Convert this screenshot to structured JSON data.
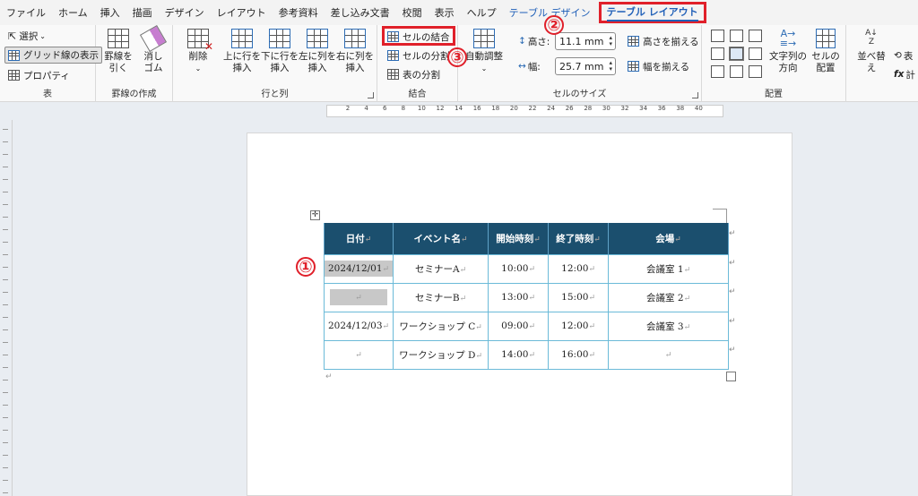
{
  "menu": {
    "items": [
      "ファイル",
      "ホーム",
      "挿入",
      "描画",
      "デザイン",
      "レイアウト",
      "参考資料",
      "差し込み文書",
      "校閲",
      "表示",
      "ヘルプ"
    ],
    "table_design": "テーブル デザイン",
    "table_layout": "テーブル レイアウト"
  },
  "ribbon": {
    "table_group": {
      "label": "表",
      "select": "選択",
      "gridlines": "グリッド線の表示",
      "properties": "プロパティ"
    },
    "draw_group": {
      "label": "罫線の作成",
      "draw_line": [
        "罫線を",
        "引く"
      ],
      "eraser": [
        "消し",
        "ゴム"
      ]
    },
    "rows_cols_group": {
      "label": "行と列",
      "delete": "削除",
      "insert_above": [
        "上に行を",
        "挿入"
      ],
      "insert_below": [
        "下に行を",
        "挿入"
      ],
      "insert_left": [
        "左に列を",
        "挿入"
      ],
      "insert_right": [
        "右に列を",
        "挿入"
      ]
    },
    "merge_group": {
      "label": "結合",
      "merge_cells": "セルの結合",
      "split_cells": "セルの分割",
      "split_table": "表の分割"
    },
    "size_group": {
      "label": "セルのサイズ",
      "autofit": "自動調整",
      "height_label": "高さ:",
      "height_value": "11.1 mm",
      "width_label": "幅:",
      "width_value": "25.7 mm",
      "distribute_rows": "高さを揃える",
      "distribute_cols": "幅を揃える"
    },
    "align_group": {
      "label": "配置",
      "text_direction": [
        "文字列の",
        "方向"
      ],
      "cell_margins": [
        "セルの",
        "配置"
      ]
    },
    "data_group": {
      "sort": "並べ替え",
      "repeat": "表",
      "formula": "計"
    }
  },
  "ruler": {
    "ticks": [
      "2",
      "4",
      "6",
      "8",
      "10",
      "12",
      "14",
      "16",
      "18",
      "20",
      "22",
      "24",
      "26",
      "28",
      "30",
      "32",
      "34",
      "36",
      "38",
      "40"
    ]
  },
  "badges": {
    "one": "①",
    "two": "②",
    "three": "③"
  },
  "table": {
    "headers": [
      "日付",
      "イベント名",
      "開始時刻",
      "終了時刻",
      "会場"
    ],
    "rows": [
      [
        "2024/12/01",
        "セミナーA",
        "10:00",
        "12:00",
        "会議室 1"
      ],
      [
        "",
        "セミナーB",
        "13:00",
        "15:00",
        "会議室 2"
      ],
      [
        "2024/12/03",
        "ワークショップ C",
        "09:00",
        "12:00",
        "会議室 3"
      ],
      [
        "",
        "ワークショップ D",
        "14:00",
        "16:00",
        ""
      ]
    ]
  },
  "marks": {
    "para": "↵",
    "move": "✛"
  }
}
